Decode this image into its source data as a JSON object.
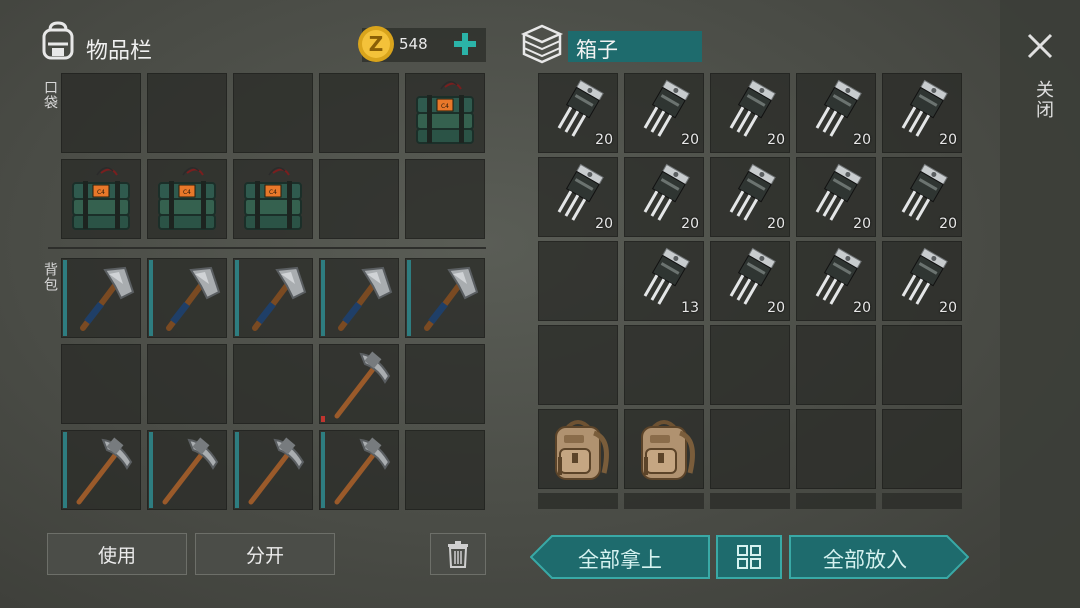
{
  "inventory": {
    "title": "物品栏",
    "pocket_label": "口袋",
    "backpack_label": "背包",
    "currency_value": "548",
    "currency_icon": "gold-coin-icon",
    "add_icon": "plus-icon"
  },
  "box": {
    "title": "箱子"
  },
  "buttons": {
    "use": "使用",
    "split": "分开",
    "take_all": "全部拿上",
    "put_all": "全部放入",
    "trash_icon": "trash-icon",
    "sort_icon": "grid-sort-icon"
  },
  "close": {
    "label": "关闭",
    "icon": "close-icon"
  },
  "colors": {
    "accent_teal": "#1e6b6d",
    "accent_border": "#39a9a6",
    "durability": "#2e7d80",
    "low_durability": "#c0352f"
  },
  "pocket_slots": [
    {
      "item": null
    },
    {
      "item": null
    },
    {
      "item": null
    },
    {
      "item": null
    },
    {
      "item": "c4-explosive-icon"
    },
    {
      "item": "c4-explosive-icon"
    },
    {
      "item": "c4-explosive-icon"
    },
    {
      "item": "c4-explosive-icon"
    },
    {
      "item": null
    },
    {
      "item": null
    }
  ],
  "backpack_slots": [
    {
      "item": "hatchet-icon",
      "durability": 1
    },
    {
      "item": "hatchet-icon",
      "durability": 1
    },
    {
      "item": "hatchet-icon",
      "durability": 1
    },
    {
      "item": "hatchet-icon",
      "durability": 1
    },
    {
      "item": "hatchet-icon",
      "durability": 1
    },
    {
      "item": null
    },
    {
      "item": null
    },
    {
      "item": null
    },
    {
      "item": "pickaxe-icon",
      "durability": 0.05
    },
    {
      "item": null
    },
    {
      "item": "pickaxe-icon",
      "durability": 1
    },
    {
      "item": "pickaxe-icon",
      "durability": 1
    },
    {
      "item": "pickaxe-icon",
      "durability": 1
    },
    {
      "item": "pickaxe-icon",
      "durability": 1
    },
    {
      "item": null
    }
  ],
  "box_slots": [
    {
      "item": "transistor-icon",
      "count": "20"
    },
    {
      "item": "transistor-icon",
      "count": "20"
    },
    {
      "item": "transistor-icon",
      "count": "20"
    },
    {
      "item": "transistor-icon",
      "count": "20"
    },
    {
      "item": "transistor-icon",
      "count": "20"
    },
    {
      "item": "transistor-icon",
      "count": "20"
    },
    {
      "item": "transistor-icon",
      "count": "20"
    },
    {
      "item": "transistor-icon",
      "count": "20"
    },
    {
      "item": "transistor-icon",
      "count": "20"
    },
    {
      "item": "transistor-icon",
      "count": "20"
    },
    {
      "item": null,
      "count": ""
    },
    {
      "item": "transistor-icon",
      "count": "13"
    },
    {
      "item": "transistor-icon",
      "count": "20"
    },
    {
      "item": "transistor-icon",
      "count": "20"
    },
    {
      "item": "transistor-icon",
      "count": "20"
    },
    {
      "item": null,
      "count": ""
    },
    {
      "item": null,
      "count": ""
    },
    {
      "item": null,
      "count": ""
    },
    {
      "item": null,
      "count": ""
    },
    {
      "item": null,
      "count": ""
    },
    {
      "item": "backpack-icon",
      "count": ""
    },
    {
      "item": "backpack-icon",
      "count": ""
    },
    {
      "item": null,
      "count": ""
    },
    {
      "item": null,
      "count": ""
    },
    {
      "item": null,
      "count": ""
    }
  ]
}
